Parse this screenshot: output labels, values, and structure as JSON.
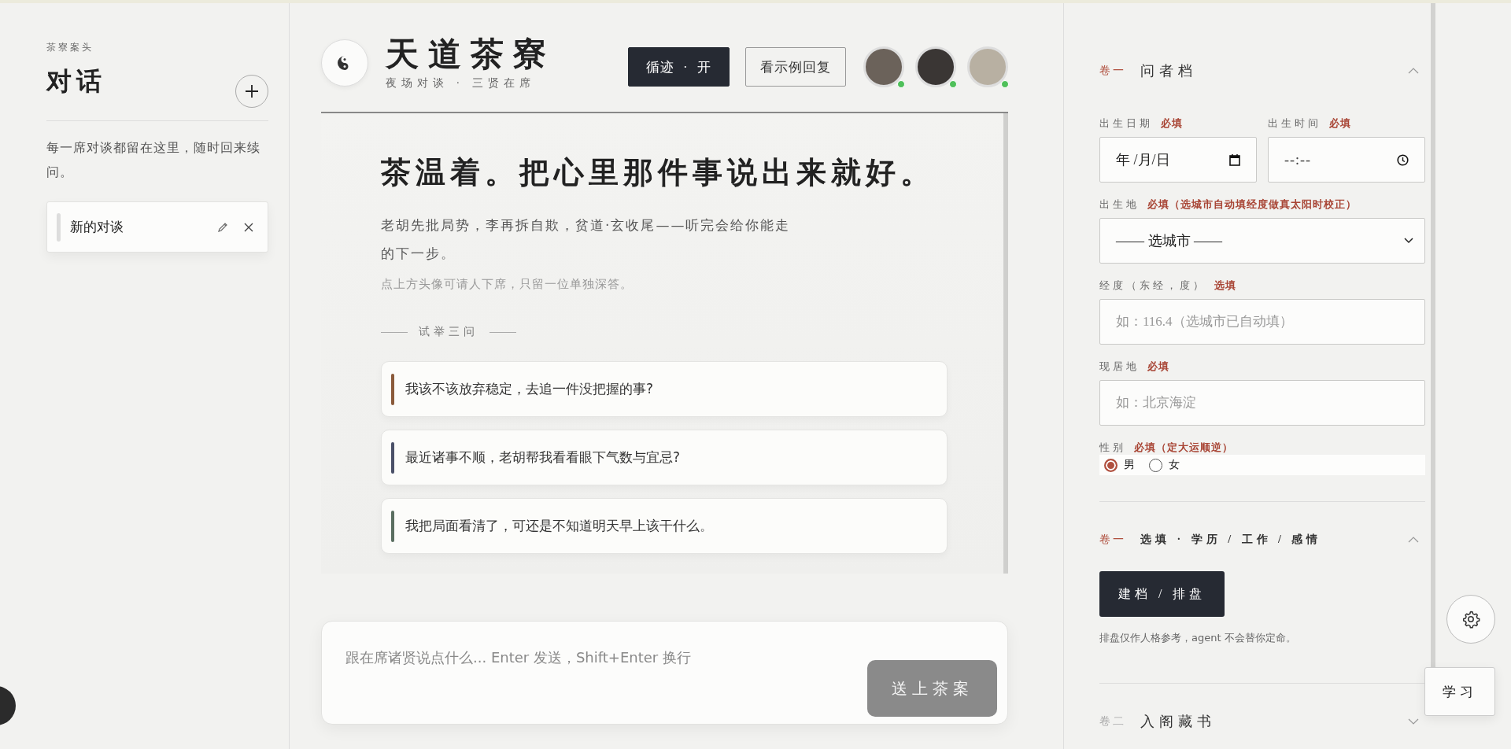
{
  "sidebar": {
    "eyebrow": "茶寮案头",
    "title": "对话",
    "description": "每一席对谈都留在这里，随时回来续问。",
    "conversations": [
      {
        "title": "新的对谈"
      }
    ]
  },
  "header": {
    "title": "天道茶寮",
    "subtitle": "夜场对谈 · 三贤在席",
    "buttons": [
      {
        "label": "循迹 · 开",
        "kind": "primary"
      },
      {
        "label": "看示例回复",
        "kind": "outline"
      }
    ],
    "avatars": [
      {
        "online": true
      },
      {
        "online": true
      },
      {
        "online": true
      }
    ]
  },
  "welcome": {
    "heading": "茶温着。把心里那件事说出来就好。",
    "intro": "老胡先批局势，李再拆自欺，贫道·玄收尾——听完会给你能走的下一步。",
    "hint": "点上方头像可请人下席，只留一位单独深答。",
    "examples_label": "试举三问",
    "examples": [
      {
        "text": "我该不该放弃稳定，去追一件没把握的事?",
        "color": "#8a5a3a"
      },
      {
        "text": "最近诸事不顺，老胡帮我看看眼下气数与宜忌?",
        "color": "#4a5068"
      },
      {
        "text": "我把局面看清了，可还是不知道明天早上该干什么。",
        "color": "#5a6e60"
      }
    ]
  },
  "composer": {
    "placeholder": "跟在席诸贤说点什么... Enter 发送，Shift+Enter 换行",
    "send_label": "送上茶案",
    "disabled": true
  },
  "profile": {
    "sections": [
      {
        "volume": "卷一",
        "title": "问者档",
        "expanded": true,
        "kind": "form",
        "fields": [
          {
            "kind": "date",
            "label": "出生日期",
            "tag": "必填",
            "value": "年 /月/日"
          },
          {
            "kind": "time",
            "label": "出生时间",
            "tag": "必填",
            "value": "--:--"
          },
          {
            "kind": "select",
            "label": "出生地",
            "tag": "必填（选城市自动填经度做真太阳时校正）",
            "value": "—— 选城市 ——"
          },
          {
            "kind": "text",
            "label": "经度（东经，度）",
            "tag": "选填",
            "placeholder": "如：116.4（选城市已自动填）"
          },
          {
            "kind": "text",
            "label": "现居地",
            "tag": "必填",
            "placeholder": "如：北京海淀"
          },
          {
            "kind": "radio",
            "label": "性别",
            "tag": "必填（定大运顺逆）",
            "options": [
              {
                "label": "男",
                "selected": true
              },
              {
                "label": "女",
                "selected": false
              }
            ]
          }
        ]
      },
      {
        "volume": "卷一",
        "title": "选填 · 学历 / 工作 / 感情",
        "expanded": true,
        "kind": "action",
        "action_label": "建档 / 排盘",
        "note": "排盘仅作人格参考，agent 不会替你定命。"
      },
      {
        "volume": "卷二",
        "title": "入阁藏书",
        "expanded": false,
        "kind": "plain"
      }
    ]
  },
  "floating": {
    "study_label": "学习"
  }
}
